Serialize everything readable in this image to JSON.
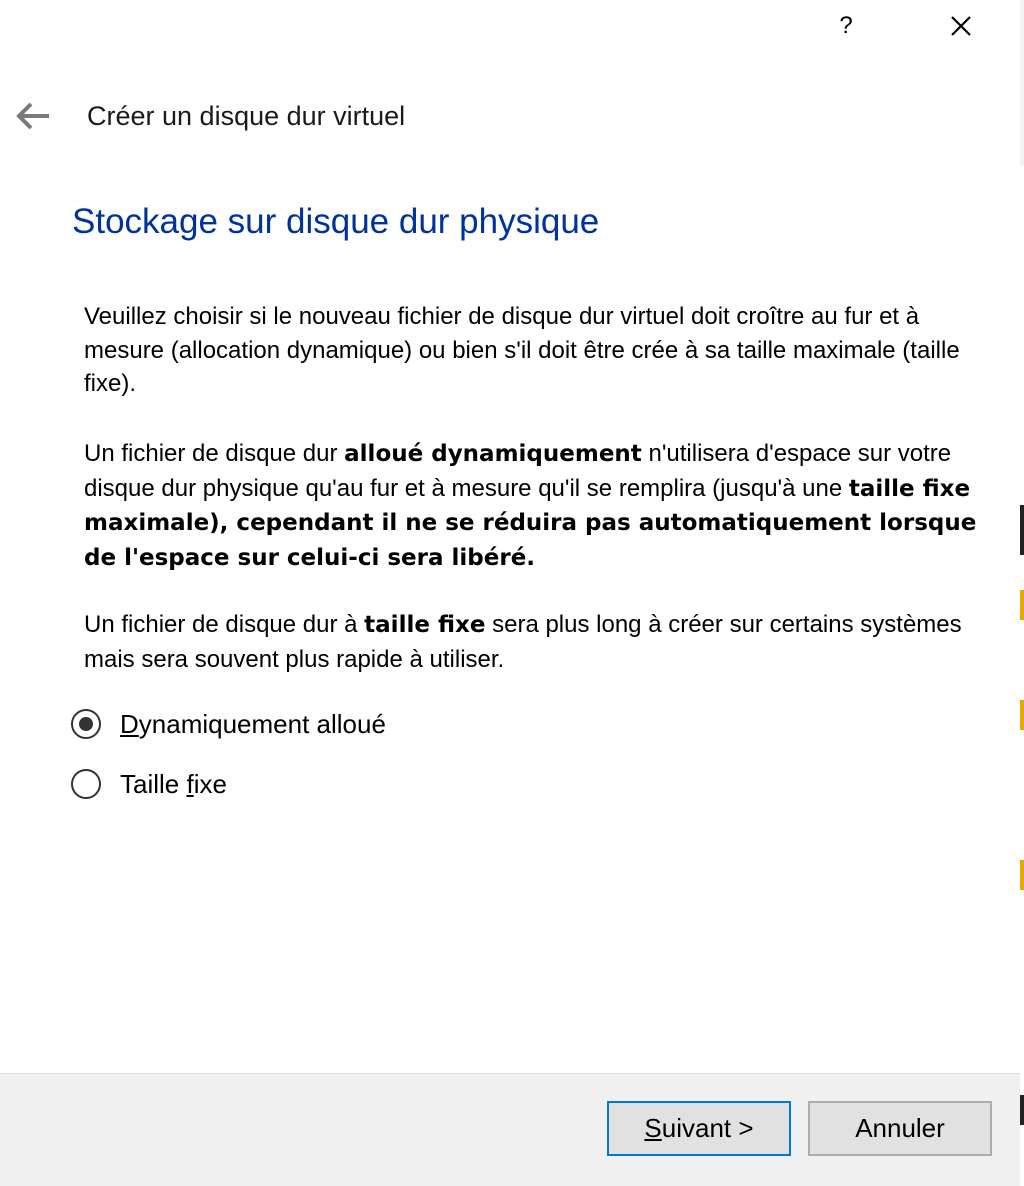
{
  "titlebar": {
    "help_label": "?",
    "close_icon": "close-icon"
  },
  "header": {
    "back_icon": "back-arrow-icon",
    "window_title": "Créer un disque dur virtuel",
    "page_heading": "Stockage sur disque dur physique"
  },
  "description": {
    "p1": "Veuillez choisir si le nouveau fichier de disque dur virtuel doit croître au fur et à mesure (allocation dynamique) ou bien s'il doit être crée à sa taille maximale (taille fixe).",
    "p2_a": "Un fichier de disque dur ",
    "p2_bold1": "alloué dynamiquement",
    "p2_b": " n'utilisera d'espace sur votre disque dur physique qu'au fur et à mesure qu'il se remplira (jusqu'à une ",
    "p2_bold2": "taille fixe maximale), cependant il ne se réduira pas automatiquement lorsque de l'espace sur celui-ci sera libéré.",
    "p3_a": "Un fichier de disque dur à ",
    "p3_bold": "taille fixe",
    "p3_b": " sera plus long à créer sur certains systèmes mais sera souvent plus rapide à utiliser."
  },
  "options": {
    "dynamic": {
      "mnemonic": "D",
      "rest": "ynamiquement alloué",
      "checked": true
    },
    "fixed": {
      "before": "Taille ",
      "mnemonic": "f",
      "after": "ixe",
      "checked": false
    }
  },
  "footer": {
    "next": {
      "mnemonic": "S",
      "rest": "uivant >"
    },
    "cancel_label": "Annuler"
  },
  "colors": {
    "heading": "#003399",
    "footer_bg": "#f0f0f0",
    "button_bg": "#e1e1e1",
    "focus_border": "#0078d7"
  }
}
